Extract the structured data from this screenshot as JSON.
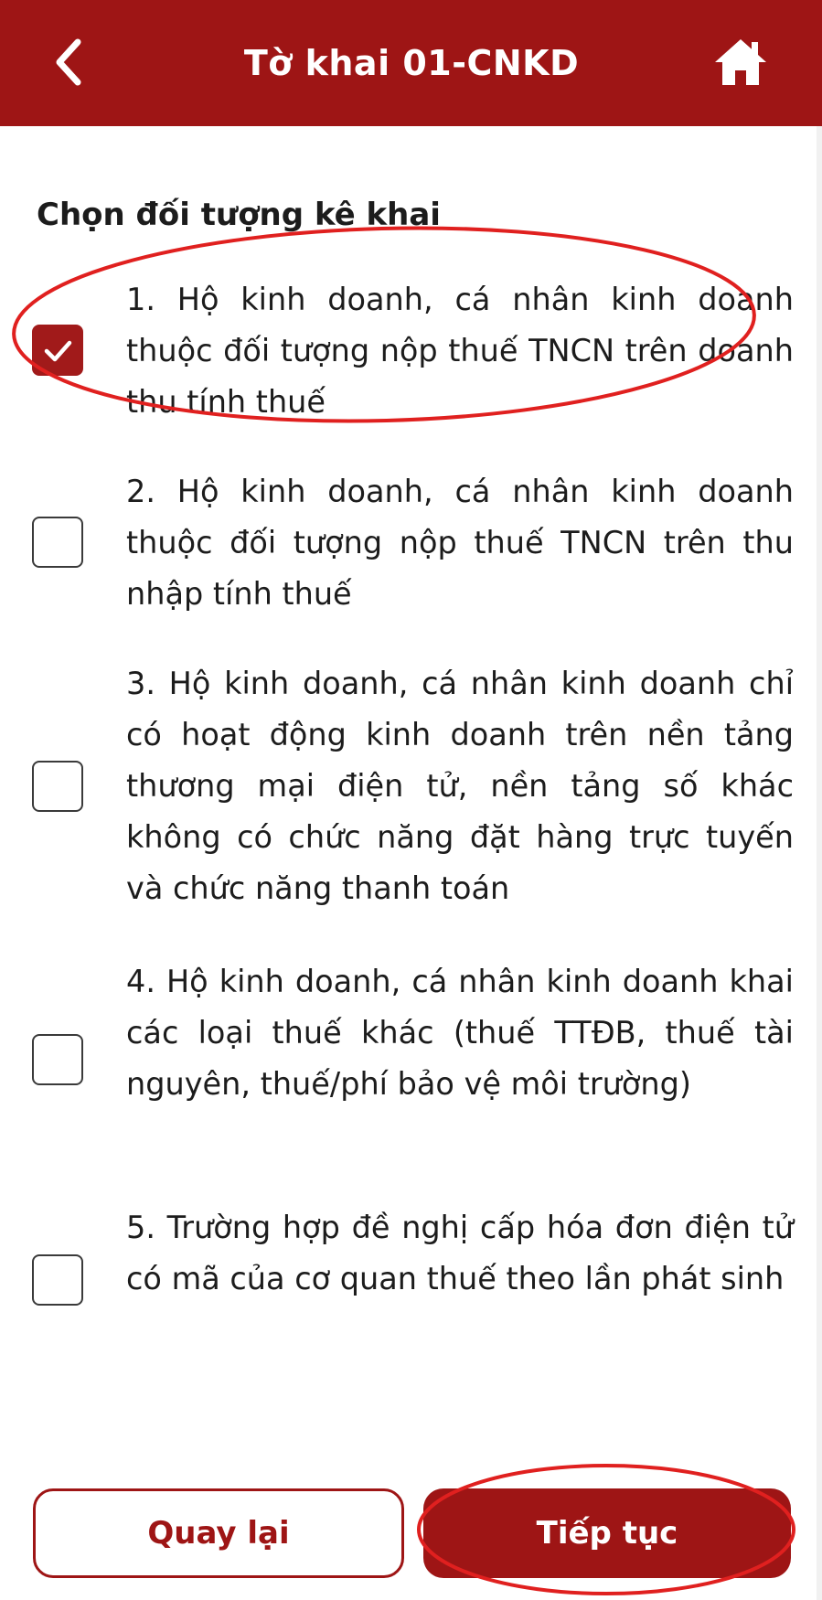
{
  "header": {
    "title": "Tờ khai 01-CNKD",
    "back_icon": "chevron-left-icon",
    "home_icon": "home-icon"
  },
  "section_title": "Chọn đối tượng kê khai",
  "options": [
    {
      "text": "1. Hộ kinh doanh, cá nhân kinh doanh thuộc đối tượng nộp thuế TNCN trên doanh thu tính thuế",
      "checked": true
    },
    {
      "text": "2. Hộ kinh doanh, cá nhân kinh doanh thuộc đối tượng nộp thuế TNCN trên thu nhập tính thuế",
      "checked": false
    },
    {
      "text": "3. Hộ kinh doanh, cá nhân kinh doanh chỉ có hoạt động kinh doanh trên nền tảng thương mại điện tử, nền tảng số khác không có chức năng đặt hàng trực tuyến và chức năng thanh toán",
      "checked": false
    },
    {
      "text": "4. Hộ kinh doanh, cá nhân kinh doanh khai các loại thuế khác (thuế TTĐB, thuế tài nguyên, thuế/phí bảo vệ môi trường)",
      "checked": false
    },
    {
      "text": "5. Trường hợp đề nghị cấp hóa đơn điện tử có mã của cơ quan thuế theo lần phát sinh",
      "checked": false
    }
  ],
  "buttons": {
    "back_label": "Quay lại",
    "next_label": "Tiếp tục"
  },
  "colors": {
    "brand": "#9e1515",
    "annotation": "#e0201f"
  }
}
